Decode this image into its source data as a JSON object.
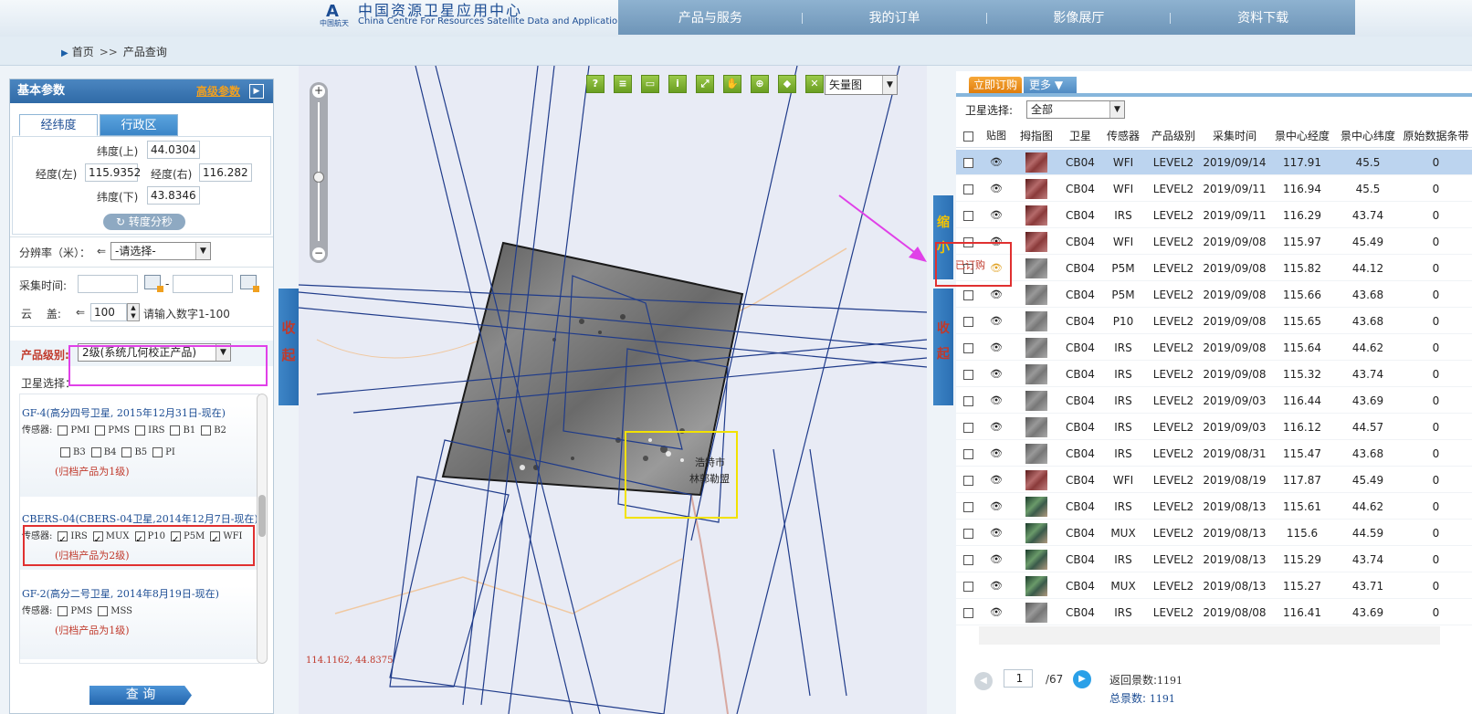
{
  "header": {
    "logo_mark": "A",
    "logo_sub": "中国航天",
    "site_title_cn": "中国资源卫星应用中心",
    "site_title_en": "China Centre For Resources Satellite Data and Application",
    "nav": [
      "产品与服务",
      "我的订单",
      "影像展厅",
      "资料下载"
    ]
  },
  "breadcrumb": {
    "home": "首页",
    "sep": ">>",
    "current": "产品查询"
  },
  "left": {
    "title": "基本参数",
    "advanced": "高级参数",
    "tabs": [
      "经纬度",
      "行政区"
    ],
    "lat_top_label": "纬度(上)",
    "lat_top": "44.0304",
    "lon_left_label": "经度(左)",
    "lon_left": "115.9352",
    "lon_right_label": "经度(右)",
    "lon_right": "116.282",
    "lat_bottom_label": "纬度(下)",
    "lat_bottom": "43.8346",
    "convert_btn": "转度分秒",
    "resolution_label": "分辨率（米）：",
    "resolution_op": "⇐",
    "resolution_value": "-请选择-",
    "time_label": "采集时间:",
    "time_dash": "-",
    "cloud_label": "云　 盖:",
    "cloud_op": "⇐",
    "cloud_value": "100",
    "cloud_hint": "请输入数字1-100",
    "product_level_label": "产品级别:",
    "product_level_value": "2级(系统几何校正产品)",
    "satellite_label": "卫星选择：",
    "sensor_label": "传感器:",
    "satellites": [
      {
        "title": "GF-4(高分四号卫星, 2015年12月31日-现在)",
        "sensors_row1": [
          "PMI",
          "PMS",
          "IRS",
          "B1",
          "B2"
        ],
        "sensors_row2": [
          "B3",
          "B4",
          "B5",
          "PI"
        ],
        "archive": "(归档产品为1级)"
      },
      {
        "title": "CBERS-04(CBERS-04卫星,2014年12月7日-现在)",
        "sensors_row1": [
          "IRS",
          "MUX",
          "P10",
          "P5M",
          "WFI"
        ],
        "archive": "(归档产品为2级)"
      },
      {
        "title": "GF-2(高分二号卫星, 2014年8月19日-现在)",
        "sensors_row1": [
          "PMS",
          "MSS"
        ],
        "archive": "(归档产品为1级)"
      }
    ],
    "query_btn": "查 询",
    "collapse": [
      "收",
      "起"
    ]
  },
  "map": {
    "layer_select": "矢量图",
    "coord_readout": "114.1162, 44.8375",
    "city_label_1": "浩特市",
    "city_label_2": "林郭勒盟",
    "zoom_in": "+",
    "zoom_out": "−",
    "tool_icons": [
      "help-icon",
      "legend-icon",
      "measure-icon",
      "info-icon",
      "fullextent-icon",
      "pan-icon",
      "globe-icon",
      "polygon-icon",
      "clear-icon"
    ],
    "tool_glyphs": [
      "?",
      "≡",
      "▭",
      "i",
      "⤢",
      "✋",
      "⊕",
      "◆",
      "✕"
    ]
  },
  "right": {
    "order_btn": "立即订购",
    "more_btn": "更多",
    "shrink": [
      "缩",
      "小"
    ],
    "collapse": [
      "收",
      "起"
    ],
    "sat_select_label": "卫星选择:",
    "sat_select_value": "全部",
    "columns": [
      "贴图",
      "拇指图",
      "卫星",
      "传感器",
      "产品级别",
      "采集时间",
      "景中心经度",
      "景中心纬度",
      "原始数据条带"
    ],
    "ordered_tag": "已订购",
    "rows": [
      {
        "sat": "CB04",
        "sensor": "WFI",
        "level": "LEVEL2",
        "date": "2019/09/14",
        "lon": "117.91",
        "lat": "45.5",
        "cloud": "0",
        "thumb": "red"
      },
      {
        "sat": "CB04",
        "sensor": "WFI",
        "level": "LEVEL2",
        "date": "2019/09/11",
        "lon": "116.94",
        "lat": "45.5",
        "cloud": "0",
        "thumb": "red"
      },
      {
        "sat": "CB04",
        "sensor": "IRS",
        "level": "LEVEL2",
        "date": "2019/09/11",
        "lon": "116.29",
        "lat": "43.74",
        "cloud": "0",
        "thumb": "red"
      },
      {
        "sat": "CB04",
        "sensor": "WFI",
        "level": "LEVEL2",
        "date": "2019/09/08",
        "lon": "115.97",
        "lat": "45.49",
        "cloud": "0",
        "thumb": "red"
      },
      {
        "sat": "CB04",
        "sensor": "P5M",
        "level": "LEVEL2",
        "date": "2019/09/08",
        "lon": "115.82",
        "lat": "44.12",
        "cloud": "0",
        "thumb": "gray"
      },
      {
        "sat": "CB04",
        "sensor": "P5M",
        "level": "LEVEL2",
        "date": "2019/09/08",
        "lon": "115.66",
        "lat": "43.68",
        "cloud": "0",
        "thumb": "gray"
      },
      {
        "sat": "CB04",
        "sensor": "P10",
        "level": "LEVEL2",
        "date": "2019/09/08",
        "lon": "115.65",
        "lat": "43.68",
        "cloud": "0",
        "thumb": "gray"
      },
      {
        "sat": "CB04",
        "sensor": "IRS",
        "level": "LEVEL2",
        "date": "2019/09/08",
        "lon": "115.64",
        "lat": "44.62",
        "cloud": "0",
        "thumb": "gray"
      },
      {
        "sat": "CB04",
        "sensor": "IRS",
        "level": "LEVEL2",
        "date": "2019/09/08",
        "lon": "115.32",
        "lat": "43.74",
        "cloud": "0",
        "thumb": "gray"
      },
      {
        "sat": "CB04",
        "sensor": "IRS",
        "level": "LEVEL2",
        "date": "2019/09/03",
        "lon": "116.44",
        "lat": "43.69",
        "cloud": "0",
        "thumb": "gray"
      },
      {
        "sat": "CB04",
        "sensor": "IRS",
        "level": "LEVEL2",
        "date": "2019/09/03",
        "lon": "116.12",
        "lat": "44.57",
        "cloud": "0",
        "thumb": "gray"
      },
      {
        "sat": "CB04",
        "sensor": "IRS",
        "level": "LEVEL2",
        "date": "2019/08/31",
        "lon": "115.47",
        "lat": "43.68",
        "cloud": "0",
        "thumb": "gray"
      },
      {
        "sat": "CB04",
        "sensor": "WFI",
        "level": "LEVEL2",
        "date": "2019/08/19",
        "lon": "117.87",
        "lat": "45.49",
        "cloud": "0",
        "thumb": "red"
      },
      {
        "sat": "CB04",
        "sensor": "IRS",
        "level": "LEVEL2",
        "date": "2019/08/13",
        "lon": "115.61",
        "lat": "44.62",
        "cloud": "0",
        "thumb": "green"
      },
      {
        "sat": "CB04",
        "sensor": "MUX",
        "level": "LEVEL2",
        "date": "2019/08/13",
        "lon": "115.6",
        "lat": "44.59",
        "cloud": "0",
        "thumb": "green"
      },
      {
        "sat": "CB04",
        "sensor": "IRS",
        "level": "LEVEL2",
        "date": "2019/08/13",
        "lon": "115.29",
        "lat": "43.74",
        "cloud": "0",
        "thumb": "green"
      },
      {
        "sat": "CB04",
        "sensor": "MUX",
        "level": "LEVEL2",
        "date": "2019/08/13",
        "lon": "115.27",
        "lat": "43.71",
        "cloud": "0",
        "thumb": "green"
      },
      {
        "sat": "CB04",
        "sensor": "IRS",
        "level": "LEVEL2",
        "date": "2019/08/08",
        "lon": "116.41",
        "lat": "43.69",
        "cloud": "0",
        "thumb": "gray"
      }
    ],
    "page_current": "1",
    "page_total": "/67",
    "returned_label": "返回景数:",
    "returned_value": "1191",
    "total_label": "总景数:",
    "total_value": "1191"
  }
}
